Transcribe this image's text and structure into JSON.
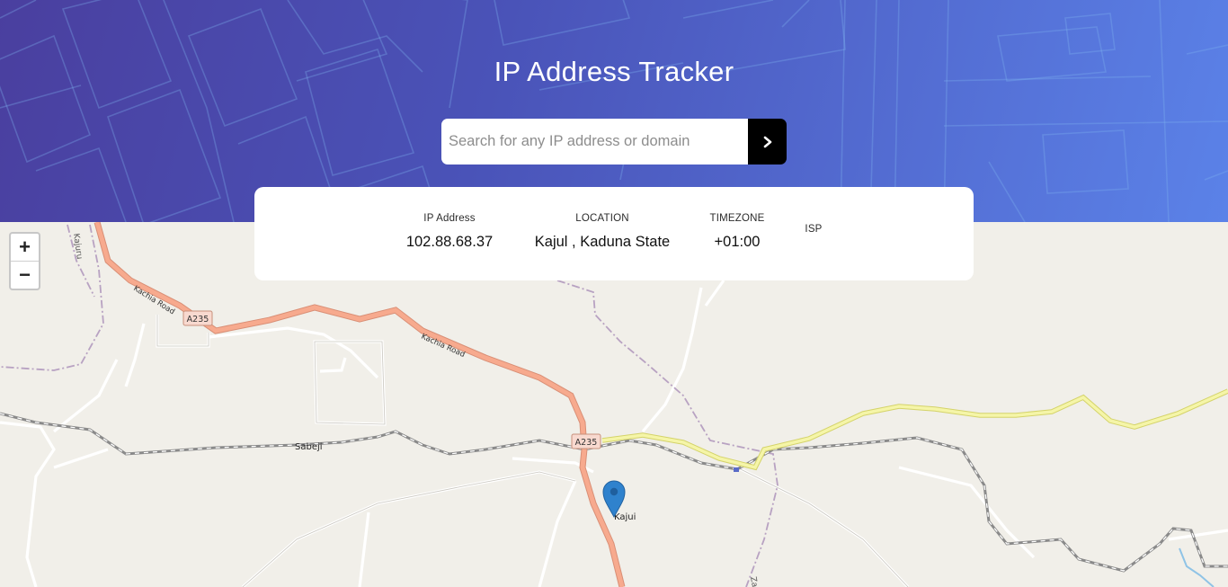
{
  "header": {
    "title": "IP Address Tracker",
    "search": {
      "placeholder": "Search for any IP address or domain",
      "value": "",
      "submit_icon": "chevron-right-icon"
    }
  },
  "info": {
    "ip": {
      "label": "IP Address",
      "value": "102.88.68.37"
    },
    "location": {
      "label": "LOCATION",
      "value": "Kajul , Kaduna State"
    },
    "timezone": {
      "label": "TIMEZONE",
      "value": "+01:00"
    },
    "isp": {
      "label": "ISP",
      "value": ""
    }
  },
  "map": {
    "zoom_in": "+",
    "zoom_out": "−",
    "marker_icon": "map-pin-icon",
    "marker_color": "#2f82cd",
    "labels": {
      "kajuru": "Kajuru",
      "kachia_road_1": "Kachia Road",
      "kachia_road_2": "Kachia Road",
      "a235_1": "A235",
      "a235_2": "A235",
      "sabeji": "Sabeji",
      "kajui": "Kajui",
      "zar": "Zar"
    }
  }
}
